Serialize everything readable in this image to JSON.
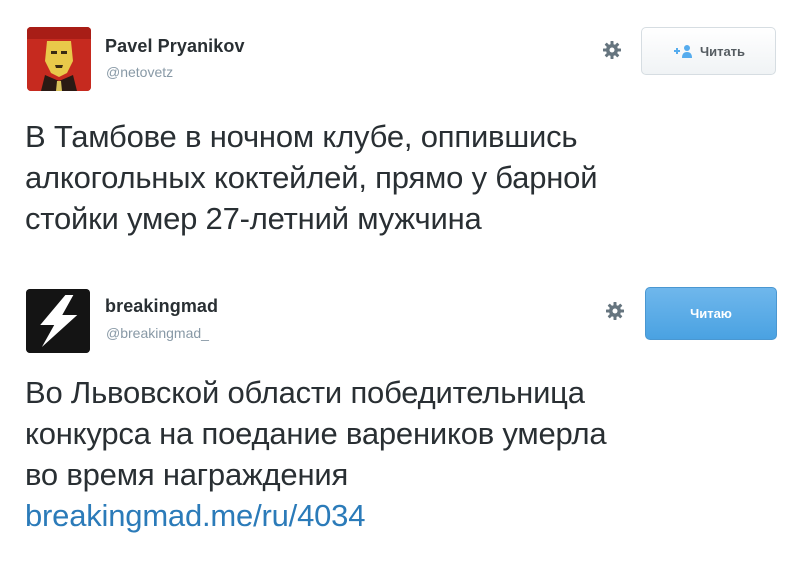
{
  "tweets": [
    {
      "name": "Pavel Pryanikov",
      "handle": "@netovetz",
      "follow_label": "Читать",
      "text_lines": [
        "В Тамбове в ночном клубе, оппившись",
        "алкогольных коктейлей, прямо у барной",
        "стойки умер 27-летний мужчина"
      ]
    },
    {
      "name": "breakingmad",
      "handle": "@breakingmad_",
      "follow_label": "Читаю",
      "text_lines": [
        "Во Львовской области победительница",
        "конкурса на поедание вареников умерла",
        "во время награждения"
      ],
      "link": "breakingmad.me/ru/4034"
    }
  ],
  "colors": {
    "text": "#292f33",
    "handle": "#8899a6",
    "link": "#2b7bb9",
    "following_button": "#55acee"
  },
  "icons": {
    "gear": "gear-icon",
    "follow": "add-user-icon",
    "avatar_1": "avatar-red-portrait",
    "avatar_2": "lightning-bolt-logo"
  }
}
